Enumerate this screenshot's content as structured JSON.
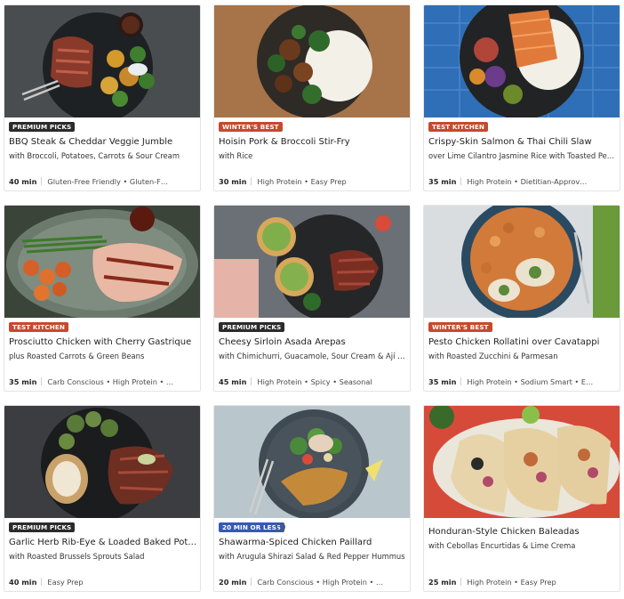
{
  "recipes": [
    {
      "badge": "PREMIUM PICKS",
      "title": "BBQ Steak & Cheddar Veggie Jumble",
      "subtitle": "with Broccoli, Potatoes, Carrots & Sour Cream",
      "time": "40 min",
      "tags": "Gluten-Free Friendly • Gluten-F…",
      "photo": "steak-veggie-photo"
    },
    {
      "badge": "WINTER'S BEST",
      "title": "Hoisin Pork & Broccoli Stir-Fry",
      "subtitle": "with Rice",
      "time": "30 min",
      "tags": "High Protein • Easy Prep",
      "photo": "pork-stirfry-photo"
    },
    {
      "badge": "TEST KITCHEN",
      "title": "Crispy-Skin Salmon & Thai Chili Slaw",
      "subtitle": "over Lime Cilantro Jasmine Rice with Toasted Pean…",
      "time": "35 min",
      "tags": "High Protein • Dietitian-Approv…",
      "photo": "salmon-bowl-photo"
    },
    {
      "badge": "TEST KITCHEN",
      "title": "Prosciutto Chicken with Cherry Gastrique",
      "subtitle": "plus Roasted Carrots & Green Beans",
      "time": "35 min",
      "tags": "Carb Conscious • High Protein • …",
      "photo": "chicken-carrots-photo"
    },
    {
      "badge": "PREMIUM PICKS",
      "title": "Cheesy Sirloin Asada Arepas",
      "subtitle": "with Chimichurri, Guacamole, Sour Cream & Ají Salsa",
      "time": "45 min",
      "tags": "High Protein • Spicy • Seasonal",
      "photo": "arepas-photo"
    },
    {
      "badge": "WINTER'S BEST",
      "title": "Pesto Chicken Rollatini over Cavatappi",
      "subtitle": "with Roasted Zucchini & Parmesan",
      "time": "35 min",
      "tags": "High Protein • Sodium Smart • E…",
      "photo": "pasta-photo"
    },
    {
      "badge": "PREMIUM PICKS",
      "title": "Garlic Herb Rib-Eye & Loaded Baked Potat…",
      "subtitle": "with Roasted Brussels Sprouts Salad",
      "time": "40 min",
      "tags": "Easy Prep",
      "photo": "ribeye-photo"
    },
    {
      "badge": "20 MIN OR LESS",
      "title": "Shawarma-Spiced Chicken Paillard",
      "subtitle": "with Arugula Shirazi Salad & Red Pepper Hummus",
      "time": "20 min",
      "tags": "Carb Conscious • High Protein • …",
      "photo": "paillard-photo",
      "info_icon": "i"
    },
    {
      "badge": "",
      "title": "Honduran-Style Chicken Baleadas",
      "subtitle": "with Cebollas Encurtidas & Lime Crema",
      "time": "25 min",
      "tags": "High Protein • Easy Prep",
      "photo": "baleadas-photo"
    }
  ]
}
